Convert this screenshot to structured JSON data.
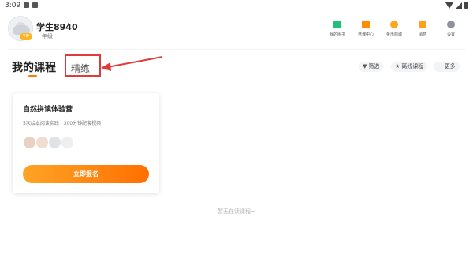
{
  "status_bar": {
    "time": "3:09"
  },
  "profile": {
    "name": "学生8940",
    "chevron": "›",
    "grade": "一年级",
    "badge": "VIP"
  },
  "top_nav": [
    {
      "label": "我的图书",
      "icon": "book-icon",
      "color": "#1fc17a"
    },
    {
      "label": "选课中心",
      "icon": "course-center-icon",
      "color": "#ff8c00"
    },
    {
      "label": "金币商城",
      "icon": "coin-mall-icon",
      "color": "#ffa51c"
    },
    {
      "label": "消息",
      "icon": "message-icon",
      "color": "#ff9f1a"
    },
    {
      "label": "设置",
      "icon": "gear-icon",
      "color": "#8e9299"
    }
  ],
  "tabs": {
    "my_courses": "我的课程",
    "quality": "精练"
  },
  "filters": {
    "filter": {
      "label": "筛选",
      "icon": "filter-icon"
    },
    "offline": {
      "label": "离线课程",
      "icon": "star-icon"
    },
    "more": {
      "label": "更多",
      "icon": "more-dots-icon"
    }
  },
  "course_card": {
    "title": "自然拼读体验营",
    "description": "5次绘本阅读实践 | 300分钟配套视频",
    "button": "立即报名"
  },
  "empty_message": "暂无在读课程~",
  "colors": {
    "accent": "#ff7a00",
    "highlight": "#e23a3a"
  }
}
